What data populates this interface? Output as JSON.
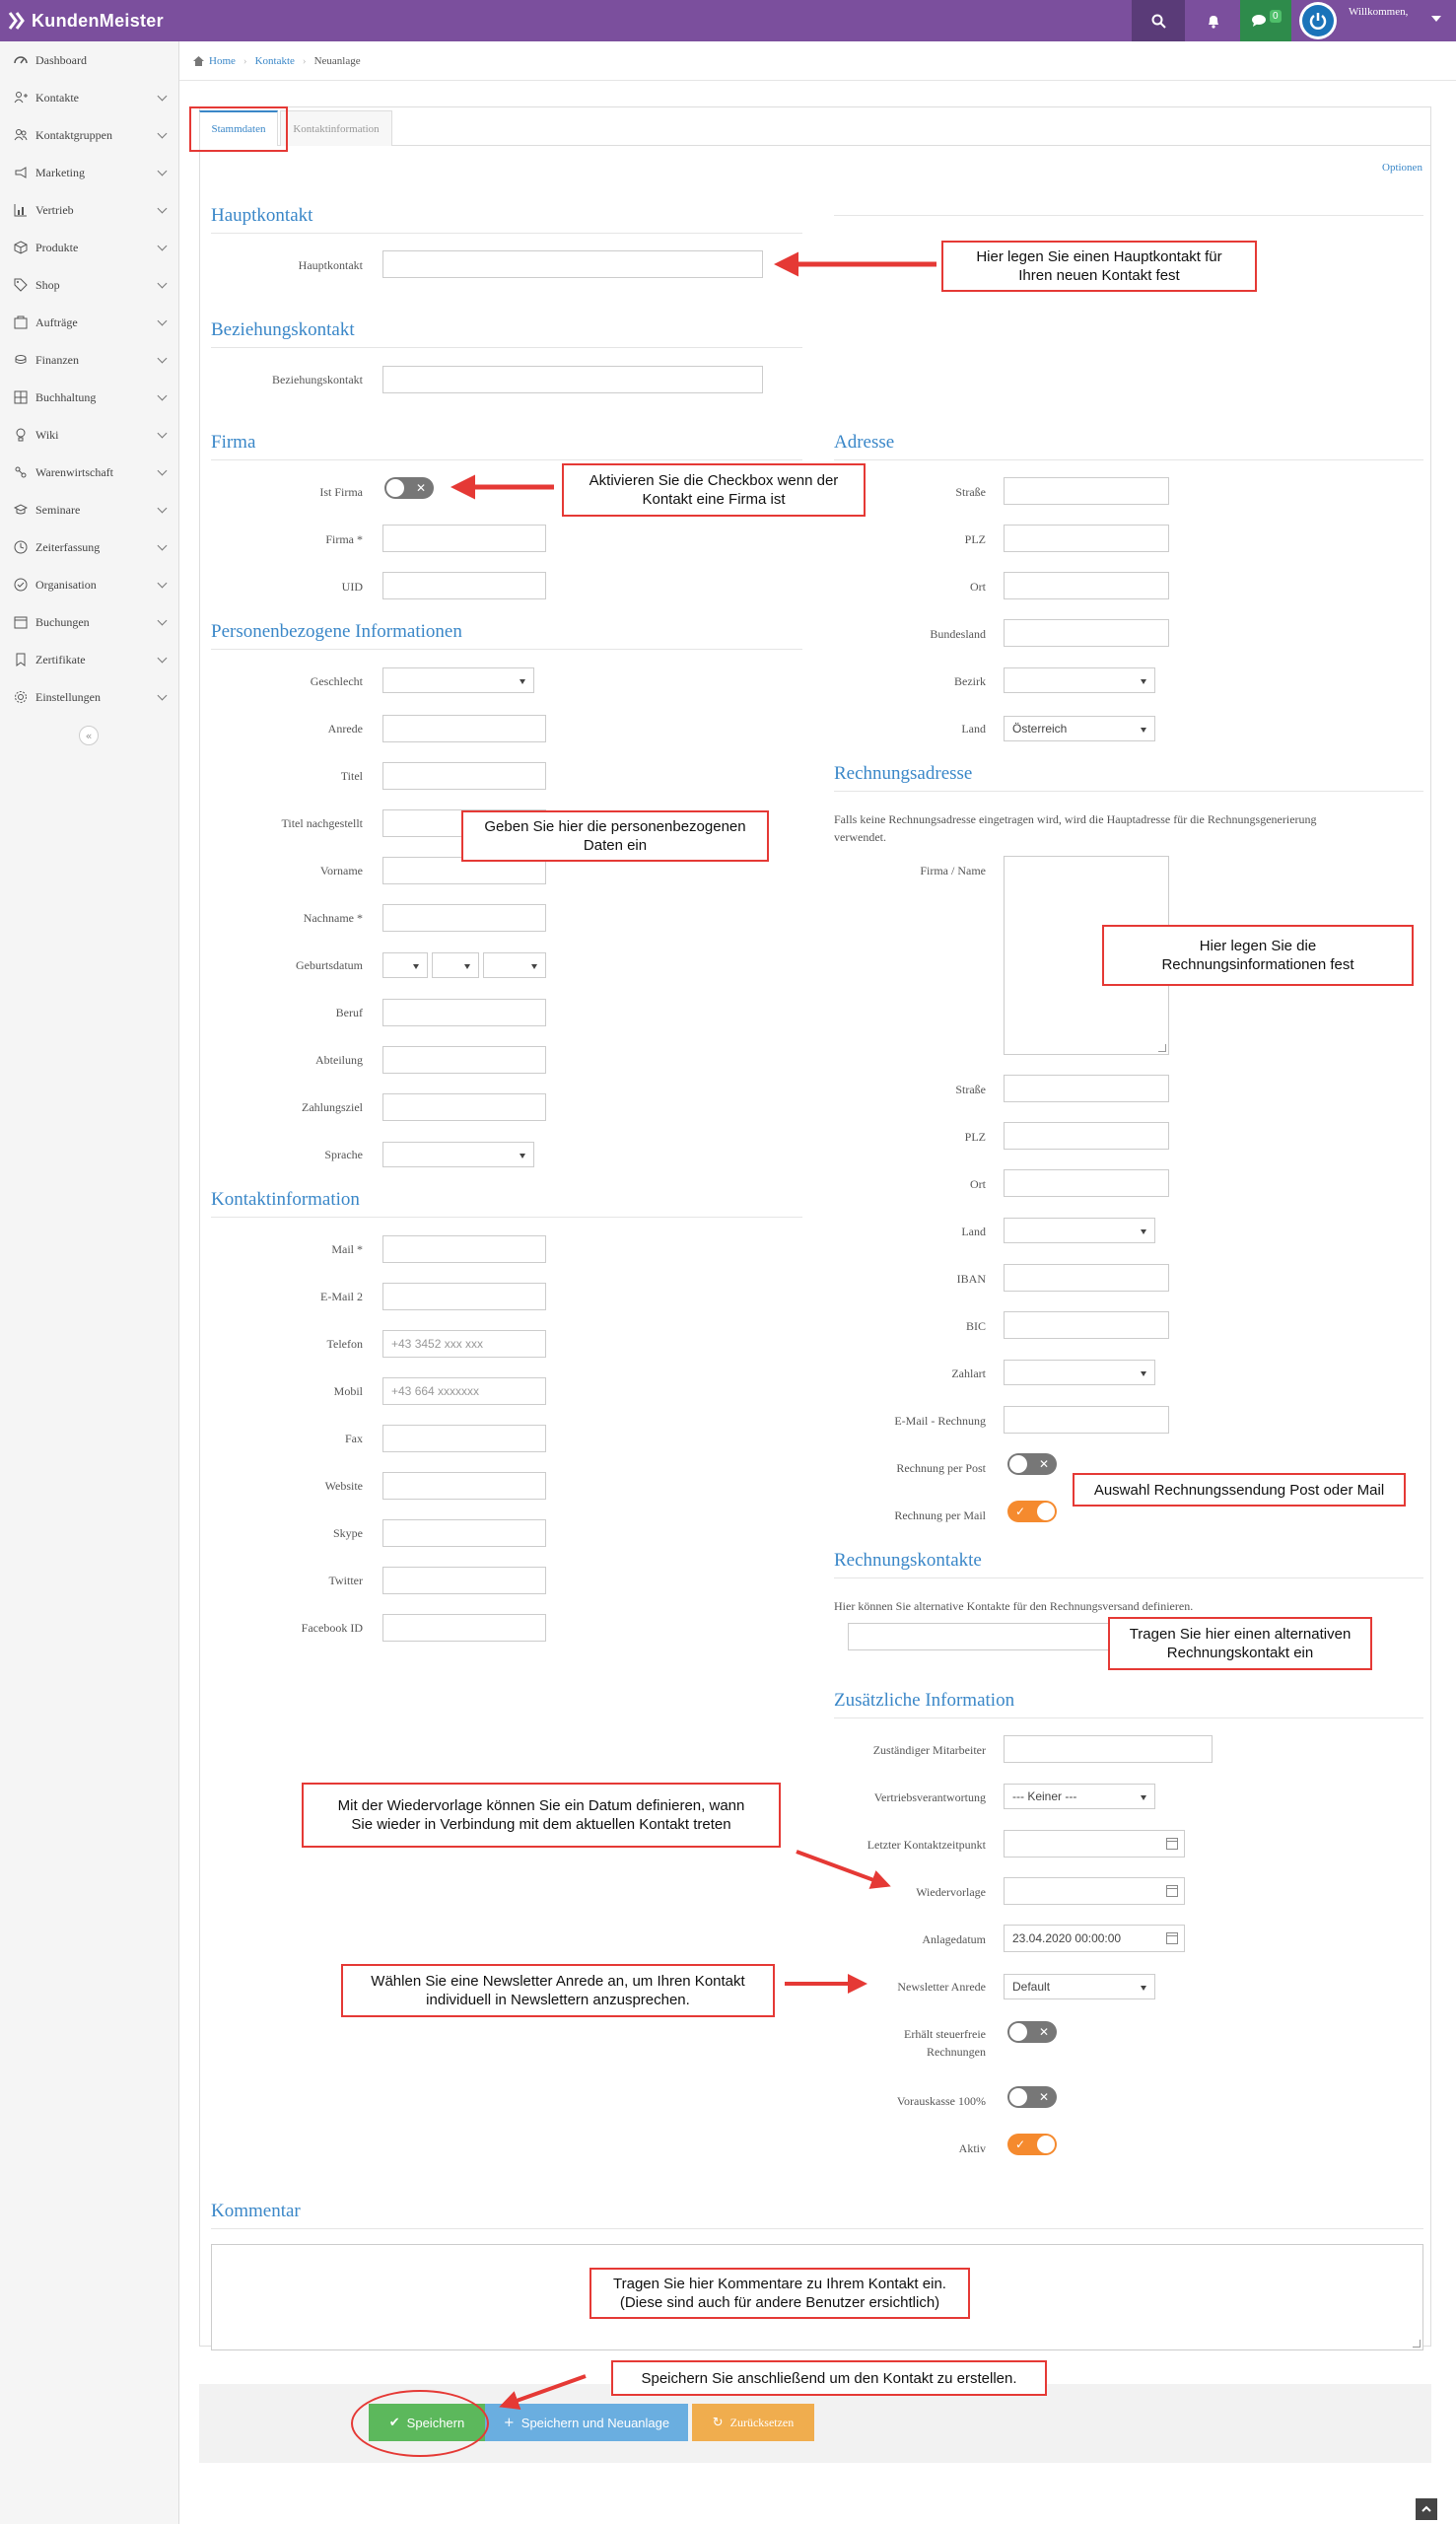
{
  "app": {
    "name": "KundenMeister",
    "welcome": "Willkommen,",
    "chat_count": "0"
  },
  "sidebar": {
    "items": [
      {
        "label": "Dashboard",
        "icon": "dashboard-icon",
        "has_children": false
      },
      {
        "label": "Kontakte",
        "icon": "user-plus-icon",
        "has_children": true
      },
      {
        "label": "Kontaktgruppen",
        "icon": "users-icon",
        "has_children": true
      },
      {
        "label": "Marketing",
        "icon": "megaphone-icon",
        "has_children": true
      },
      {
        "label": "Vertrieb",
        "icon": "chart-icon",
        "has_children": true
      },
      {
        "label": "Produkte",
        "icon": "box-icon",
        "has_children": true
      },
      {
        "label": "Shop",
        "icon": "tag-icon",
        "has_children": true
      },
      {
        "label": "Aufträge",
        "icon": "order-icon",
        "has_children": true
      },
      {
        "label": "Finanzen",
        "icon": "coins-icon",
        "has_children": true
      },
      {
        "label": "Buchhaltung",
        "icon": "ledger-icon",
        "has_children": true
      },
      {
        "label": "Wiki",
        "icon": "lightbulb-icon",
        "has_children": true
      },
      {
        "label": "Warenwirtschaft",
        "icon": "warehouse-icon",
        "has_children": true
      },
      {
        "label": "Seminare",
        "icon": "graduation-icon",
        "has_children": true
      },
      {
        "label": "Zeiterfassung",
        "icon": "clock-icon",
        "has_children": true
      },
      {
        "label": "Organisation",
        "icon": "organisation-icon",
        "has_children": true
      },
      {
        "label": "Buchungen",
        "icon": "calendar-icon",
        "has_children": true
      },
      {
        "label": "Zertifikate",
        "icon": "bookmark-icon",
        "has_children": true
      },
      {
        "label": "Einstellungen",
        "icon": "gear-icon",
        "has_children": true
      }
    ]
  },
  "breadcrumb": {
    "home": "Home",
    "contacts": "Kontakte",
    "current": "Neuanlage"
  },
  "tabs": {
    "stammdaten": "Stammdaten",
    "kontaktinformation": "Kontaktinformation"
  },
  "options_link": "Optionen",
  "sections": {
    "hauptkontakt": "Hauptkontakt",
    "beziehungskontakt": "Beziehungskontakt",
    "firma": "Firma",
    "personen": "Personenbezogene Informationen",
    "kontaktinfo": "Kontaktinformation",
    "adresse": "Adresse",
    "rechnungsadresse": "Rechnungsadresse",
    "rechnungskontakte": "Rechnungskontakte",
    "zusaetzlich": "Zusätzliche Information",
    "kommentar": "Kommentar"
  },
  "labels": {
    "hauptkontakt": "Hauptkontakt",
    "beziehungskontakt": "Beziehungskontakt",
    "ist_firma": "Ist Firma",
    "firma": "Firma *",
    "uid": "UID",
    "geschlecht": "Geschlecht",
    "anrede": "Anrede",
    "titel": "Titel",
    "titel_nach": "Titel nachgestellt",
    "vorname": "Vorname",
    "nachname": "Nachname *",
    "geburtsdatum": "Geburtsdatum",
    "beruf": "Beruf",
    "abteilung": "Abteilung",
    "zahlungsziel": "Zahlungsziel",
    "sprache": "Sprache",
    "mail": "Mail *",
    "email2": "E-Mail 2",
    "telefon": "Telefon",
    "mobil": "Mobil",
    "fax": "Fax",
    "website": "Website",
    "skype": "Skype",
    "twitter": "Twitter",
    "facebook": "Facebook ID",
    "strasse": "Straße",
    "plz": "PLZ",
    "ort": "Ort",
    "bundesland": "Bundesland",
    "bezirk": "Bezirk",
    "land": "Land",
    "firma_name": "Firma / Name",
    "iban": "IBAN",
    "bic": "BIC",
    "zahlart": "Zahlart",
    "email_rechnung": "E-Mail - Rechnung",
    "rechnung_post": "Rechnung per Post",
    "rechnung_mail": "Rechnung per Mail",
    "mitarbeiter": "Zuständiger Mitarbeiter",
    "vertrieb": "Vertriebsverantwortung",
    "letzter_kontakt": "Letzter Kontaktzeitpunkt",
    "wiedervorlage": "Wiedervorlage",
    "anlagedatum": "Anlagedatum",
    "newsletter_anrede": "Newsletter Anrede",
    "steuerfrei_1": "Erhält steuerfreie",
    "steuerfrei_2": "Rechnungen",
    "vorauskasse": "Vorauskasse 100%",
    "aktiv": "Aktiv"
  },
  "values": {
    "land": "Österreich",
    "vertrieb": "--- Keiner ---",
    "anlagedatum": "23.04.2020 00:00:00",
    "newsletter_anrede": "Default"
  },
  "placeholders": {
    "telefon": "+43 3452 xxx xxx",
    "mobil": "+43 664 xxxxxxx"
  },
  "toggles": {
    "ist_firma": false,
    "rechnung_post": false,
    "rechnung_mail": true,
    "steuerfrei": false,
    "vorauskasse": false,
    "aktiv": true
  },
  "help": {
    "rechnungsadresse_1": "Falls keine Rechnungsadresse eingetragen wird, wird die Hauptadresse für die Rechnungsgenerierung",
    "rechnungsadresse_2": "verwendet.",
    "rechnungskontakte": "Hier können Sie alternative Kontakte für den Rechnungsversand definieren."
  },
  "buttons": {
    "save": "Speichern",
    "save_new": "Speichern und Neuanlage",
    "reset": "Zurücksetzen"
  },
  "annotations": {
    "hauptkontakt_1": "Hier legen Sie einen Hauptkontakt für",
    "hauptkontakt_2": "Ihren neuen Kontakt fest",
    "firma_1": "Aktivieren Sie die Checkbox wenn der",
    "firma_2": "Kontakt eine Firma ist",
    "personen_1": "Geben Sie hier die personenbezogenen",
    "personen_2": "Daten ein",
    "rechnung_1": "Hier legen Sie die",
    "rechnung_2": "Rechnungsinformationen fest",
    "versand": "Auswahl Rechnungssendung Post oder Mail",
    "rkontakt_1": "Tragen Sie hier einen alternativen",
    "rkontakt_2": "Rechnungskontakt ein",
    "wiedervorlage_1": "Mit der Wiedervorlage können Sie ein Datum definieren, wann",
    "wiedervorlage_2": "Sie wieder in Verbindung mit dem aktuellen Kontakt treten",
    "newsletter_1": "Wählen Sie eine Newsletter Anrede an, um Ihren Kontakt",
    "newsletter_2": "individuell in Newslettern anzusprechen.",
    "kommentar_1": "Tragen Sie hier Kommentare zu Ihrem Kontakt ein.",
    "kommentar_2": "(Diese sind auch für andere Benutzer ersichtlich)",
    "speichern": "Speichern Sie anschließend um den Kontakt zu erstellen."
  },
  "colors": {
    "brand": "#7b4f9d",
    "accent": "#3a87c8",
    "save": "#5cb85c",
    "save_new": "#6aaee0",
    "reset": "#f0ad4e",
    "annotation": "#e53935",
    "toggle_on": "#f58a2e"
  }
}
